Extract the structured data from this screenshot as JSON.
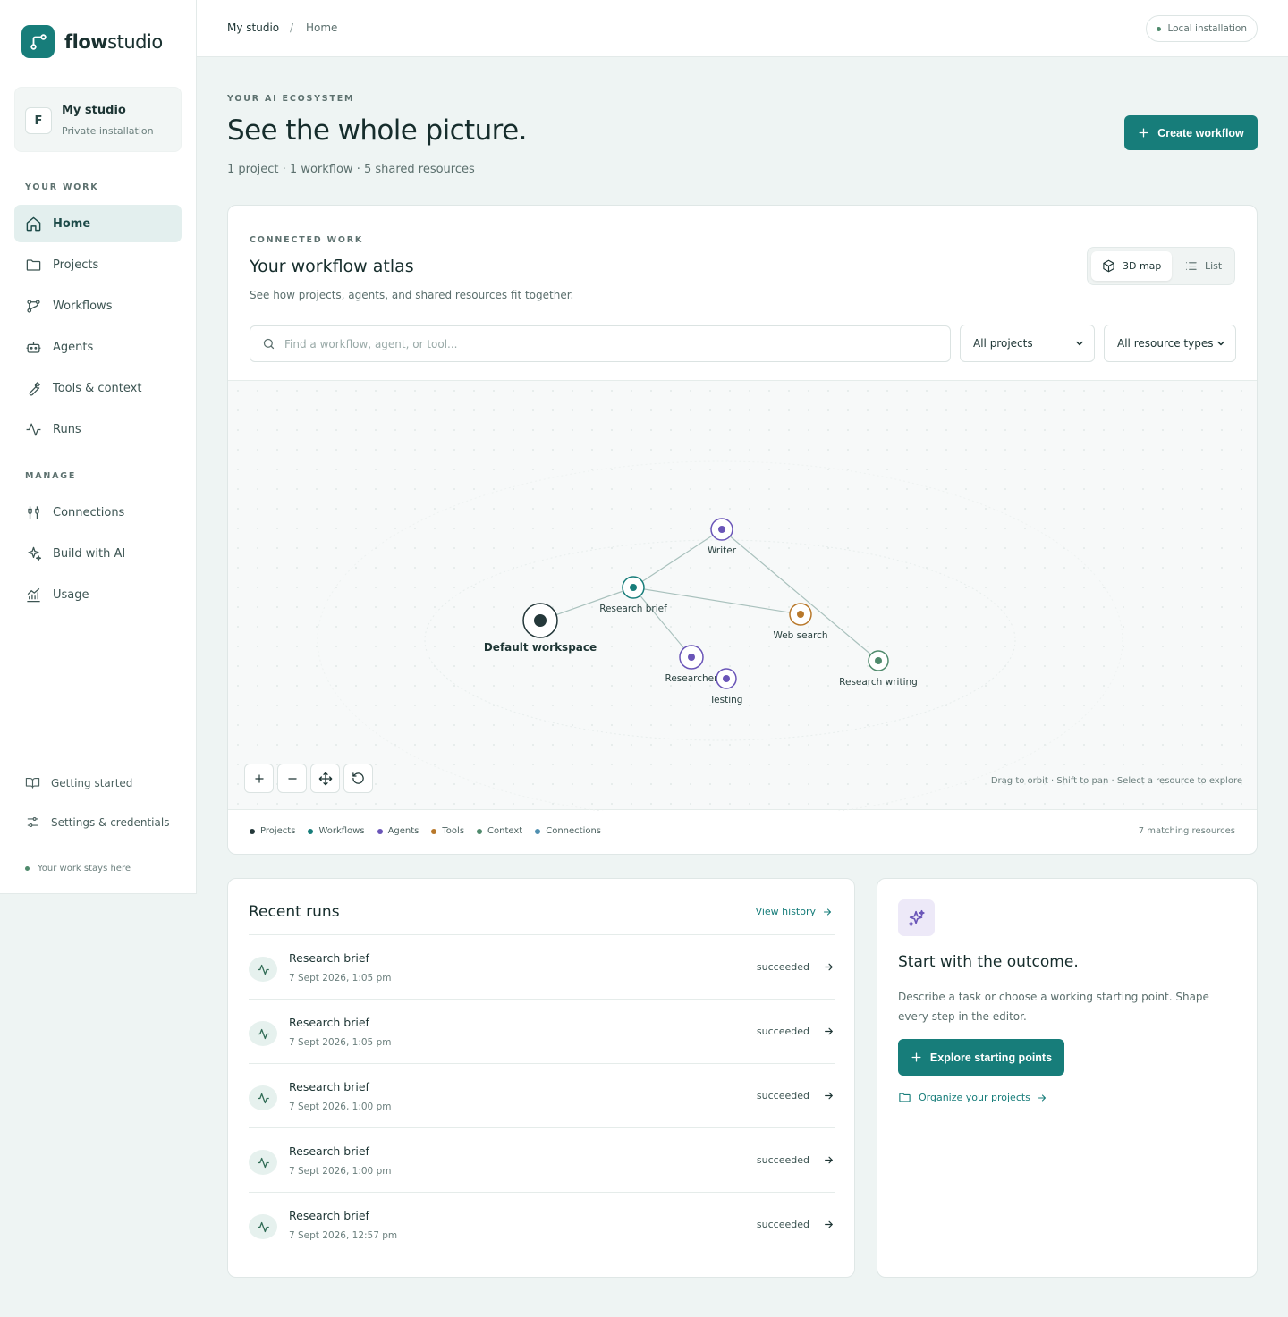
{
  "brand": {
    "name_bold": "flow",
    "name_light": "studio"
  },
  "studio": {
    "avatar": "F",
    "name": "My studio",
    "subtitle": "Private installation"
  },
  "sidebar": {
    "your_work_label": "YOUR WORK",
    "your_work": [
      {
        "label": "Home",
        "icon": "home-icon",
        "active": true
      },
      {
        "label": "Projects",
        "icon": "folder-icon"
      },
      {
        "label": "Workflows",
        "icon": "workflow-icon"
      },
      {
        "label": "Agents",
        "icon": "bot-icon"
      },
      {
        "label": "Tools & context",
        "icon": "wrench-icon"
      },
      {
        "label": "Runs",
        "icon": "activity-icon"
      }
    ],
    "manage_label": "MANAGE",
    "manage": [
      {
        "label": "Connections",
        "icon": "connections-icon"
      },
      {
        "label": "Build with AI",
        "icon": "sparkles-icon"
      },
      {
        "label": "Usage",
        "icon": "chart-icon"
      }
    ],
    "footer": [
      {
        "label": "Getting started",
        "icon": "book-icon"
      },
      {
        "label": "Settings & credentials",
        "icon": "settings-icon"
      }
    ],
    "note": "Your work stays here"
  },
  "topbar": {
    "crumb_root": "My studio",
    "crumb_sep": "/",
    "crumb_current": "Home",
    "status": "Local installation"
  },
  "hero": {
    "eyebrow": "YOUR AI ECOSYSTEM",
    "title": "See the whole picture.",
    "subtitle": "1 project · 1 workflow · 5 shared resources",
    "create_button": "Create workflow"
  },
  "atlas": {
    "eyebrow": "CONNECTED WORK",
    "title": "Your workflow atlas",
    "description": "See how projects, agents, and shared resources fit together.",
    "view_3d": "3D map",
    "view_list": "List",
    "search_placeholder": "Find a workflow, agent, or tool...",
    "project_filter": "All projects",
    "type_filter": "All resource types",
    "hint": "Drag to orbit · Shift to pan · Select a resource to explore",
    "nodes": [
      {
        "label": "Default workspace",
        "type": "project"
      },
      {
        "label": "Research brief",
        "type": "workflow"
      },
      {
        "label": "Writer",
        "type": "agent"
      },
      {
        "label": "Web search",
        "type": "tool"
      },
      {
        "label": "Researcher",
        "type": "agent"
      },
      {
        "label": "Testing",
        "type": "agent"
      },
      {
        "label": "Research writing",
        "type": "context"
      }
    ],
    "legend": [
      {
        "label": "Projects",
        "color": "#24383a"
      },
      {
        "label": "Workflows",
        "color": "#177d7a"
      },
      {
        "label": "Agents",
        "color": "#6a55b8"
      },
      {
        "label": "Tools",
        "color": "#b8782a"
      },
      {
        "label": "Context",
        "color": "#4f8a6c"
      },
      {
        "label": "Connections",
        "color": "#4f8fb0"
      }
    ],
    "match_count": "7 matching resources"
  },
  "runs": {
    "title": "Recent runs",
    "view_history": "View history",
    "items": [
      {
        "name": "Research brief",
        "time": "7 Sept 2026, 1:05 pm",
        "status": "succeeded"
      },
      {
        "name": "Research brief",
        "time": "7 Sept 2026, 1:05 pm",
        "status": "succeeded"
      },
      {
        "name": "Research brief",
        "time": "7 Sept 2026, 1:00 pm",
        "status": "succeeded"
      },
      {
        "name": "Research brief",
        "time": "7 Sept 2026, 1:00 pm",
        "status": "succeeded"
      },
      {
        "name": "Research brief",
        "time": "7 Sept 2026, 12:57 pm",
        "status": "succeeded"
      }
    ]
  },
  "outcome": {
    "title": "Start with the outcome.",
    "description": "Describe a task or choose a working starting point. Shape every step in the editor.",
    "explore_button": "Explore starting points",
    "organize_link": "Organize your projects"
  },
  "colors": {
    "accent": "#177d7a",
    "background": "#eef4f3",
    "agent": "#6a55b8",
    "tool": "#b8782a"
  }
}
